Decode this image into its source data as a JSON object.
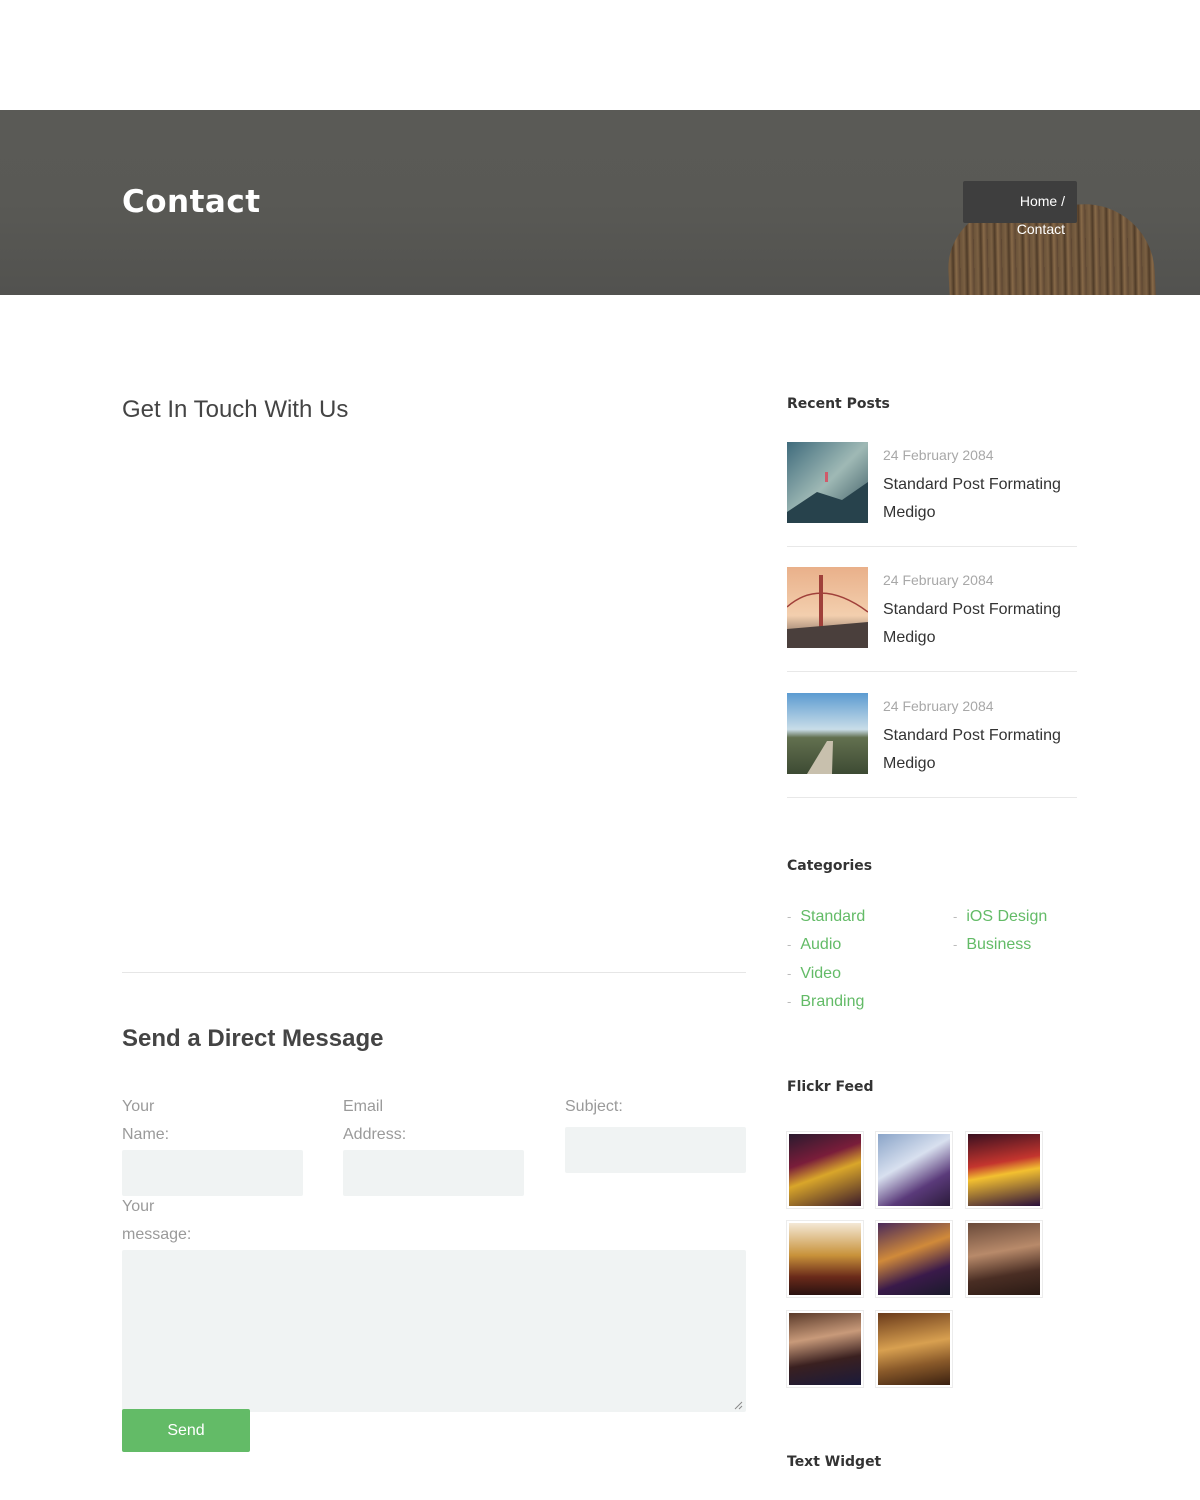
{
  "hero": {
    "title": "Contact",
    "breadcrumb": {
      "home": "Home /",
      "current": "Contact"
    }
  },
  "main": {
    "contact_heading": "Get In Touch With Us",
    "form": {
      "heading": "Send a Direct Message",
      "name_label_1": "Your",
      "name_label_2": "Name:",
      "email_label_1": "Email",
      "email_label_2": "Address:",
      "subject_label": "Subject:",
      "message_label_1": "Your",
      "message_label_2": "message:",
      "name_value": "",
      "email_value": "",
      "subject_value": "",
      "message_value": "",
      "submit_label": "Send"
    }
  },
  "sidebar": {
    "recent_posts": {
      "title": "Recent Posts",
      "posts": [
        {
          "date": "24 February 2084",
          "title": "Standard Post Formating Medigo",
          "thumb_icon": "mountain-photo"
        },
        {
          "date": "24 February 2084",
          "title": "Standard Post Formating Medigo",
          "thumb_icon": "bridge-photo"
        },
        {
          "date": "24 February 2084",
          "title": "Standard Post Formating Medigo",
          "thumb_icon": "road-photo"
        }
      ]
    },
    "categories": {
      "title": "Categories",
      "left": [
        "Standard",
        "Audio",
        "Video",
        "Branding"
      ],
      "right": [
        "iOS Design",
        "Business"
      ],
      "dash": "-"
    },
    "flickr": {
      "title": "Flickr Feed",
      "photo_icon": "event-photo"
    },
    "text_widget": {
      "title": "Text Widget"
    }
  },
  "colors": {
    "accent": "#63bb67",
    "hero_bg": "#595955",
    "input_bg": "#f0f3f3"
  }
}
